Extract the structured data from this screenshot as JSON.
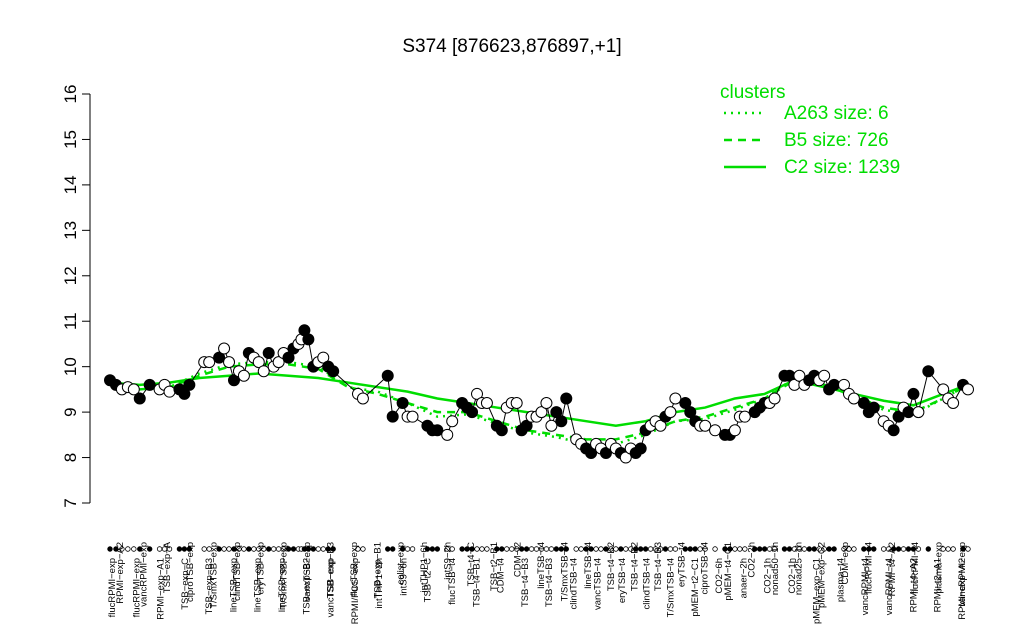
{
  "chart_data": {
    "type": "line",
    "title": "S374 [876623,876897,+1]",
    "xlabel": "",
    "ylabel": "",
    "ylim": [
      7,
      16
    ],
    "yticks": [
      7,
      8,
      9,
      10,
      11,
      12,
      13,
      14,
      15,
      16
    ],
    "grid": false,
    "legend_position": "top-right",
    "legend": {
      "title": "clusters",
      "entries": [
        {
          "label": "A263 size: 6",
          "style": "dotted"
        },
        {
          "label": "B5 size: 726",
          "style": "dashed"
        },
        {
          "label": "C2 size: 1239",
          "style": "solid"
        }
      ]
    },
    "labels_top": [
      "RPMI−exp−A2",
      "vancRPMI−exp",
      "TSB−exp−A",
      "ciproTSB−exp",
      "T/SmxTSB−exp",
      "clindTSB−exp",
      "eryTSB−exp",
      "T/SmxTSB−exp",
      "vancTSB−exp",
      "TSB−exp−B3",
      "flucTSB−exp",
      "TSB−exp−B1",
      "colist−exp",
      "intTHP1−6h",
      "intS9−2h",
      "TSB−t4−C",
      "TSB−t2−B1",
      "CDM−t2",
      "lineTSB−t4",
      "T/SmxTSB−t4",
      "lineTSB−t4",
      "TSB−t4−B2",
      "TSB−t4−B2",
      "TSB−t4−B3",
      "eryTSB−t4",
      "ciproTSB−t4",
      "pMEM−t4−C1",
      "CO2−2h",
      "nonad50−1h",
      "nonad25−1h",
      "pMEM−exp−C2",
      "CDM−exp",
      "flucRPMI−t4",
      "RPMI−t4−A2",
      "flucRPMI−t4",
      "plasma−exp",
      "vancRPMI−exp"
    ],
    "labels_bottom": [
      "flucRPMI−exp",
      "flucRPMI−exp",
      "RPMI−exp−A1",
      "TSB−exp−C",
      "TSB−exp−B3",
      "lineTSB−exp",
      "lineTSB−exp",
      "lineTSB−exp",
      "TSB−exp−B2",
      "vancTSB−exp",
      "RPMI/FCS−exp",
      "intTHP1−2h",
      "intS9−6h",
      "TSB−t2−C",
      "flucTSB−t4",
      "TSB−t4−B1",
      "CDM−t4",
      "TSB−t4−B3",
      "TSB−t4−B3",
      "clindTSB−t4",
      "vancTSB−t4",
      "eryTSB−t4",
      "clindTSB−t4",
      "T/SmxTSB−t4",
      "pMEM−t2−C1",
      "CO2−6h",
      "anaer−2h",
      "CO2−1h",
      "CO2−1h",
      "pMEM−exp−C1",
      "plasma−t4",
      "vancRPMI−t4",
      "vancRPMI−t4",
      "RPMI−t4−A2",
      "RPMI−t2−A1",
      "RPMI−exp−A2"
    ],
    "points": [
      {
        "x": 0,
        "y": 9.7,
        "filled": true
      },
      {
        "x": 0.6,
        "y": 9.6,
        "filled": true
      },
      {
        "x": 1.2,
        "y": 9.5,
        "filled": false
      },
      {
        "x": 1.8,
        "y": 9.55,
        "filled": false
      },
      {
        "x": 2.4,
        "y": 9.5,
        "filled": false
      },
      {
        "x": 3.0,
        "y": 9.3,
        "filled": true
      },
      {
        "x": 4.0,
        "y": 9.6,
        "filled": true
      },
      {
        "x": 5.0,
        "y": 9.5,
        "filled": false
      },
      {
        "x": 5.5,
        "y": 9.6,
        "filled": false
      },
      {
        "x": 6.0,
        "y": 9.45,
        "filled": false
      },
      {
        "x": 7.0,
        "y": 9.5,
        "filled": true
      },
      {
        "x": 7.5,
        "y": 9.4,
        "filled": true
      },
      {
        "x": 8.0,
        "y": 9.6,
        "filled": true
      },
      {
        "x": 9.5,
        "y": 10.1,
        "filled": false
      },
      {
        "x": 10.0,
        "y": 10.1,
        "filled": false
      },
      {
        "x": 11.0,
        "y": 10.2,
        "filled": true
      },
      {
        "x": 11.5,
        "y": 10.4,
        "filled": false
      },
      {
        "x": 12.0,
        "y": 10.1,
        "filled": false
      },
      {
        "x": 12.5,
        "y": 9.7,
        "filled": true
      },
      {
        "x": 13.0,
        "y": 9.9,
        "filled": false
      },
      {
        "x": 13.5,
        "y": 9.8,
        "filled": false
      },
      {
        "x": 14.0,
        "y": 10.3,
        "filled": true
      },
      {
        "x": 14.5,
        "y": 10.2,
        "filled": false
      },
      {
        "x": 15.0,
        "y": 10.1,
        "filled": false
      },
      {
        "x": 15.5,
        "y": 9.9,
        "filled": false
      },
      {
        "x": 16.0,
        "y": 10.3,
        "filled": true
      },
      {
        "x": 16.5,
        "y": 10.0,
        "filled": false
      },
      {
        "x": 17.0,
        "y": 10.1,
        "filled": false
      },
      {
        "x": 17.5,
        "y": 10.3,
        "filled": false
      },
      {
        "x": 18.0,
        "y": 10.2,
        "filled": true
      },
      {
        "x": 18.5,
        "y": 10.4,
        "filled": true
      },
      {
        "x": 19.0,
        "y": 10.5,
        "filled": false
      },
      {
        "x": 19.3,
        "y": 10.6,
        "filled": false
      },
      {
        "x": 19.6,
        "y": 10.8,
        "filled": true
      },
      {
        "x": 20.0,
        "y": 10.6,
        "filled": true
      },
      {
        "x": 20.5,
        "y": 10.0,
        "filled": true
      },
      {
        "x": 21.0,
        "y": 10.1,
        "filled": false
      },
      {
        "x": 21.5,
        "y": 10.2,
        "filled": false
      },
      {
        "x": 22.0,
        "y": 10.0,
        "filled": true
      },
      {
        "x": 22.5,
        "y": 9.9,
        "filled": true
      },
      {
        "x": 25.0,
        "y": 9.4,
        "filled": false
      },
      {
        "x": 25.5,
        "y": 9.3,
        "filled": false
      },
      {
        "x": 28.0,
        "y": 9.8,
        "filled": true
      },
      {
        "x": 28.5,
        "y": 8.9,
        "filled": true
      },
      {
        "x": 29.5,
        "y": 9.2,
        "filled": true
      },
      {
        "x": 30.0,
        "y": 8.9,
        "filled": false
      },
      {
        "x": 30.5,
        "y": 8.9,
        "filled": false
      },
      {
        "x": 32.0,
        "y": 8.7,
        "filled": true
      },
      {
        "x": 32.5,
        "y": 8.6,
        "filled": true
      },
      {
        "x": 33.0,
        "y": 8.6,
        "filled": true
      },
      {
        "x": 34.0,
        "y": 8.5,
        "filled": false
      },
      {
        "x": 34.5,
        "y": 8.8,
        "filled": false
      },
      {
        "x": 35.5,
        "y": 9.2,
        "filled": true
      },
      {
        "x": 36.0,
        "y": 9.1,
        "filled": true
      },
      {
        "x": 36.5,
        "y": 9.0,
        "filled": true
      },
      {
        "x": 37.0,
        "y": 9.4,
        "filled": false
      },
      {
        "x": 37.5,
        "y": 9.2,
        "filled": false
      },
      {
        "x": 38.0,
        "y": 9.2,
        "filled": false
      },
      {
        "x": 39.0,
        "y": 8.7,
        "filled": true
      },
      {
        "x": 39.5,
        "y": 8.6,
        "filled": true
      },
      {
        "x": 40.0,
        "y": 9.1,
        "filled": false
      },
      {
        "x": 40.5,
        "y": 9.2,
        "filled": false
      },
      {
        "x": 41.0,
        "y": 9.2,
        "filled": false
      },
      {
        "x": 41.5,
        "y": 8.6,
        "filled": true
      },
      {
        "x": 42.0,
        "y": 8.7,
        "filled": true
      },
      {
        "x": 42.5,
        "y": 8.9,
        "filled": false
      },
      {
        "x": 43.0,
        "y": 8.9,
        "filled": false
      },
      {
        "x": 43.5,
        "y": 9.0,
        "filled": false
      },
      {
        "x": 44.0,
        "y": 9.2,
        "filled": false
      },
      {
        "x": 44.5,
        "y": 8.7,
        "filled": false
      },
      {
        "x": 45.0,
        "y": 9.0,
        "filled": true
      },
      {
        "x": 45.5,
        "y": 8.8,
        "filled": true
      },
      {
        "x": 46.0,
        "y": 9.3,
        "filled": true
      },
      {
        "x": 47.0,
        "y": 8.4,
        "filled": false
      },
      {
        "x": 47.5,
        "y": 8.3,
        "filled": false
      },
      {
        "x": 48.0,
        "y": 8.2,
        "filled": true
      },
      {
        "x": 48.5,
        "y": 8.1,
        "filled": true
      },
      {
        "x": 49.0,
        "y": 8.3,
        "filled": false
      },
      {
        "x": 49.5,
        "y": 8.2,
        "filled": false
      },
      {
        "x": 50.0,
        "y": 8.1,
        "filled": true
      },
      {
        "x": 50.5,
        "y": 8.3,
        "filled": false
      },
      {
        "x": 51.0,
        "y": 8.2,
        "filled": false
      },
      {
        "x": 51.5,
        "y": 8.1,
        "filled": true
      },
      {
        "x": 52.0,
        "y": 8.0,
        "filled": false
      },
      {
        "x": 52.5,
        "y": 8.2,
        "filled": false
      },
      {
        "x": 53.0,
        "y": 8.1,
        "filled": true
      },
      {
        "x": 53.5,
        "y": 8.2,
        "filled": true
      },
      {
        "x": 54.0,
        "y": 8.6,
        "filled": true
      },
      {
        "x": 54.5,
        "y": 8.7,
        "filled": false
      },
      {
        "x": 55.0,
        "y": 8.8,
        "filled": false
      },
      {
        "x": 55.5,
        "y": 8.7,
        "filled": false
      },
      {
        "x": 56.0,
        "y": 8.9,
        "filled": true
      },
      {
        "x": 56.5,
        "y": 9.0,
        "filled": false
      },
      {
        "x": 57.0,
        "y": 9.3,
        "filled": false
      },
      {
        "x": 58.0,
        "y": 9.2,
        "filled": true
      },
      {
        "x": 58.5,
        "y": 9.0,
        "filled": true
      },
      {
        "x": 59.0,
        "y": 8.8,
        "filled": true
      },
      {
        "x": 59.5,
        "y": 8.7,
        "filled": false
      },
      {
        "x": 60.0,
        "y": 8.7,
        "filled": false
      },
      {
        "x": 61.0,
        "y": 8.6,
        "filled": false
      },
      {
        "x": 62.0,
        "y": 8.5,
        "filled": true
      },
      {
        "x": 62.5,
        "y": 8.5,
        "filled": true
      },
      {
        "x": 63.0,
        "y": 8.6,
        "filled": false
      },
      {
        "x": 63.5,
        "y": 8.9,
        "filled": false
      },
      {
        "x": 64.0,
        "y": 8.9,
        "filled": false
      },
      {
        "x": 65.0,
        "y": 9.0,
        "filled": true
      },
      {
        "x": 65.5,
        "y": 9.1,
        "filled": true
      },
      {
        "x": 66.0,
        "y": 9.2,
        "filled": true
      },
      {
        "x": 66.5,
        "y": 9.2,
        "filled": false
      },
      {
        "x": 67.0,
        "y": 9.3,
        "filled": false
      },
      {
        "x": 68.0,
        "y": 9.8,
        "filled": true
      },
      {
        "x": 68.5,
        "y": 9.8,
        "filled": true
      },
      {
        "x": 69.0,
        "y": 9.6,
        "filled": false
      },
      {
        "x": 69.5,
        "y": 9.8,
        "filled": false
      },
      {
        "x": 70.0,
        "y": 9.6,
        "filled": false
      },
      {
        "x": 70.5,
        "y": 9.7,
        "filled": true
      },
      {
        "x": 71.0,
        "y": 9.8,
        "filled": true
      },
      {
        "x": 71.5,
        "y": 9.7,
        "filled": false
      },
      {
        "x": 72.0,
        "y": 9.8,
        "filled": false
      },
      {
        "x": 72.5,
        "y": 9.5,
        "filled": true
      },
      {
        "x": 73.0,
        "y": 9.6,
        "filled": true
      },
      {
        "x": 74.0,
        "y": 9.6,
        "filled": false
      },
      {
        "x": 74.5,
        "y": 9.4,
        "filled": false
      },
      {
        "x": 75.0,
        "y": 9.3,
        "filled": false
      },
      {
        "x": 76.0,
        "y": 9.2,
        "filled": true
      },
      {
        "x": 76.5,
        "y": 9.0,
        "filled": true
      },
      {
        "x": 77.0,
        "y": 9.1,
        "filled": true
      },
      {
        "x": 78.0,
        "y": 8.8,
        "filled": false
      },
      {
        "x": 78.5,
        "y": 8.7,
        "filled": false
      },
      {
        "x": 79.0,
        "y": 8.6,
        "filled": true
      },
      {
        "x": 79.5,
        "y": 8.9,
        "filled": true
      },
      {
        "x": 80.0,
        "y": 9.1,
        "filled": false
      },
      {
        "x": 80.5,
        "y": 9.0,
        "filled": true
      },
      {
        "x": 81.0,
        "y": 9.4,
        "filled": true
      },
      {
        "x": 81.5,
        "y": 9.0,
        "filled": false
      },
      {
        "x": 82.5,
        "y": 9.9,
        "filled": true
      },
      {
        "x": 84.0,
        "y": 9.5,
        "filled": false
      },
      {
        "x": 84.5,
        "y": 9.3,
        "filled": false
      },
      {
        "x": 85.0,
        "y": 9.2,
        "filled": false
      },
      {
        "x": 86.0,
        "y": 9.6,
        "filled": true
      },
      {
        "x": 86.5,
        "y": 9.5,
        "filled": false
      }
    ],
    "series": [
      {
        "style": "solid",
        "x": [
          0,
          3,
          6,
          9,
          12,
          15,
          18,
          21,
          24,
          27,
          30,
          33,
          36,
          39,
          42,
          45,
          48,
          51,
          54,
          57,
          60,
          63,
          66,
          69,
          72,
          75,
          78,
          81,
          84,
          86.5
        ],
        "y": [
          9.65,
          9.6,
          9.65,
          9.75,
          9.8,
          9.85,
          9.8,
          9.75,
          9.65,
          9.55,
          9.45,
          9.3,
          9.2,
          9.1,
          9.0,
          8.9,
          8.8,
          8.7,
          8.8,
          9.0,
          9.1,
          9.3,
          9.4,
          9.7,
          9.55,
          9.4,
          9.25,
          9.15,
          9.4,
          9.6
        ]
      },
      {
        "style": "dashed",
        "x": [
          0,
          3,
          6,
          9,
          12,
          15,
          18,
          21,
          24,
          27,
          30,
          33,
          36,
          39,
          42,
          45,
          48,
          51,
          54,
          57,
          60,
          63,
          66,
          69,
          72,
          75,
          78,
          81,
          84,
          86.5
        ],
        "y": [
          9.6,
          9.5,
          9.55,
          9.8,
          10.0,
          10.05,
          10.05,
          9.95,
          9.55,
          9.4,
          9.2,
          9.0,
          9.0,
          8.8,
          8.6,
          8.5,
          8.4,
          8.4,
          8.55,
          8.8,
          8.9,
          9.1,
          9.3,
          9.7,
          9.6,
          9.35,
          9.1,
          9.0,
          9.3,
          9.6
        ]
      },
      {
        "style": "dotted",
        "x": [
          0,
          3,
          6,
          9,
          12,
          15,
          18,
          21,
          24,
          27,
          30,
          33,
          36,
          39,
          42,
          45,
          48,
          51,
          54,
          57,
          60,
          63,
          66,
          69,
          72,
          75,
          78,
          81,
          84,
          86.5
        ],
        "y": [
          9.6,
          9.5,
          9.55,
          9.85,
          10.05,
          10.1,
          10.1,
          10.0,
          9.55,
          9.45,
          9.2,
          8.9,
          8.95,
          8.75,
          8.55,
          8.45,
          8.3,
          8.3,
          8.5,
          8.8,
          8.85,
          9.05,
          9.3,
          9.75,
          9.6,
          9.35,
          9.05,
          8.95,
          9.3,
          9.6
        ]
      }
    ]
  },
  "colors": {
    "line": "#00dd00",
    "point": "#000000",
    "axis": "#000000"
  }
}
